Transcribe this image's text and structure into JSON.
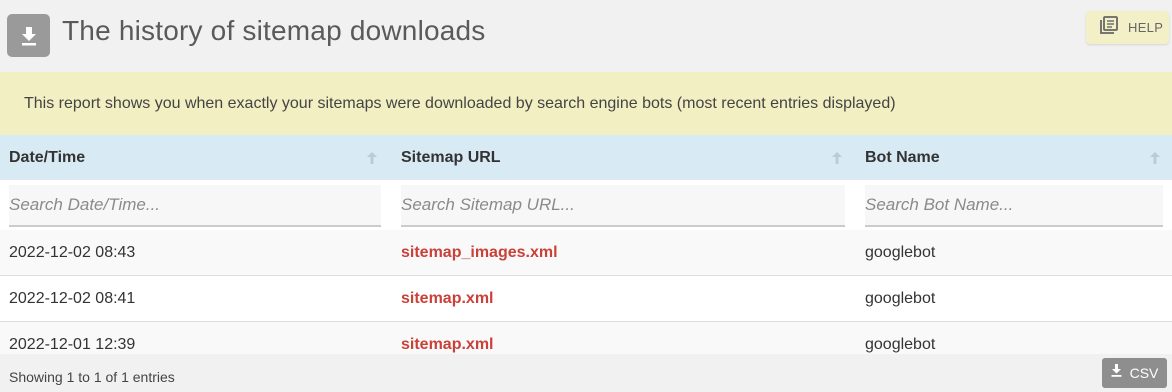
{
  "header": {
    "title": "The history of sitemap downloads",
    "icon": "download-icon",
    "help_label": "HELP"
  },
  "banner": {
    "text": "This report shows you when exactly your sitemaps were downloaded by search engine bots (most recent entries displayed)"
  },
  "table": {
    "columns": [
      {
        "label": "Date/Time",
        "placeholder": "Search Date/Time..."
      },
      {
        "label": "Sitemap URL",
        "placeholder": "Search Sitemap URL..."
      },
      {
        "label": "Bot Name",
        "placeholder": "Search Bot Name..."
      }
    ],
    "rows": [
      {
        "datetime": "2022-12-02 08:43",
        "sitemap": "sitemap_images.xml",
        "bot": "googlebot"
      },
      {
        "datetime": "2022-12-02 08:41",
        "sitemap": "sitemap.xml",
        "bot": "googlebot"
      },
      {
        "datetime": "2022-12-01 12:39",
        "sitemap": "sitemap.xml",
        "bot": "googlebot"
      }
    ]
  },
  "footer": {
    "info": "Showing 1 to 1 of 1 entries",
    "csv_label": "CSV"
  },
  "colors": {
    "header_bg": "#f1f1f1",
    "banner_bg": "#f2efc3",
    "table_head_bg": "#d8ebf4",
    "link": "#c9423a",
    "icon_box": "#9a9a9a"
  }
}
